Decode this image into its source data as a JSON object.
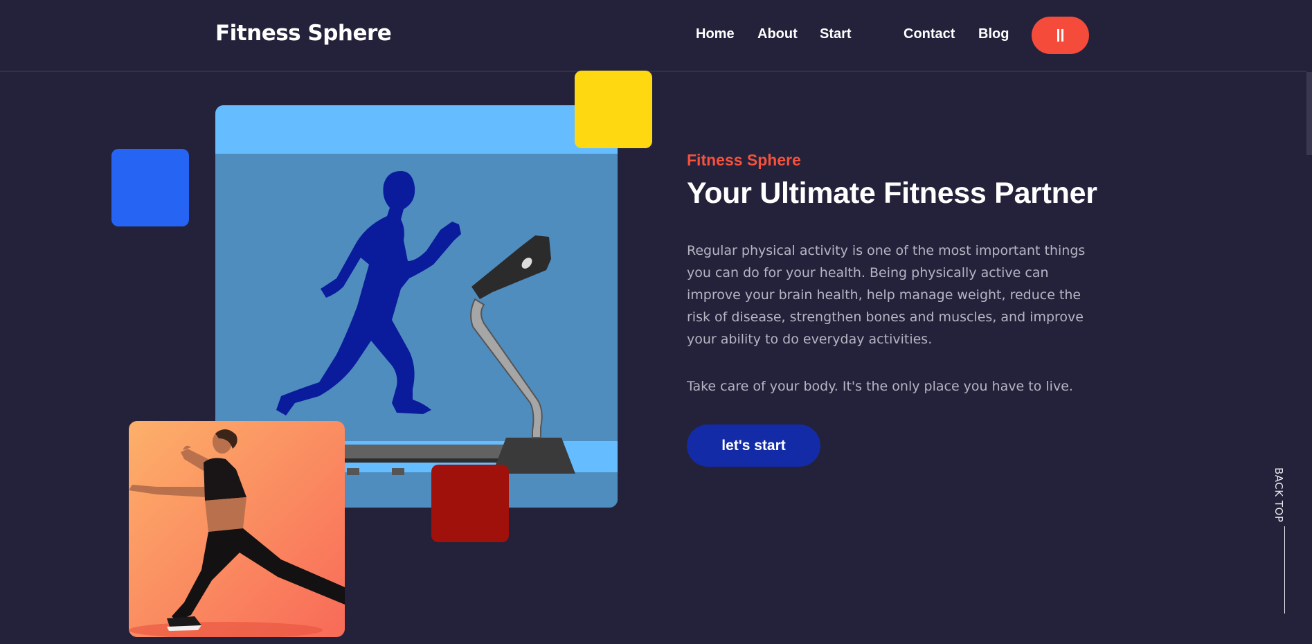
{
  "nav": {
    "brand": "Fitness Sphere",
    "links": [
      "Home",
      "About",
      "Start",
      "Contact",
      "Blog"
    ],
    "menu_icon": "pause-bars-icon"
  },
  "hero": {
    "eyebrow": "Fitness Sphere",
    "headline": "Your Ultimate Fitness Partner",
    "paragraph": "Regular physical activity is one of the most important things you can do for your health. Being physically active can improve your brain health, help manage weight, reduce the risk of disease, strengthen bones and muscles, and improve your ability to do everyday activities.",
    "quote": "Take care of your body. It's the only place you have to live.",
    "cta_label": "let's start"
  },
  "back_top_label": "BACK TOP",
  "colors": {
    "background": "#24223a",
    "accent": "#f54b3b",
    "cta": "#142ba7",
    "deco_blue": "#2664f4",
    "deco_yellow": "#fed912",
    "deco_red": "#a0110c"
  }
}
